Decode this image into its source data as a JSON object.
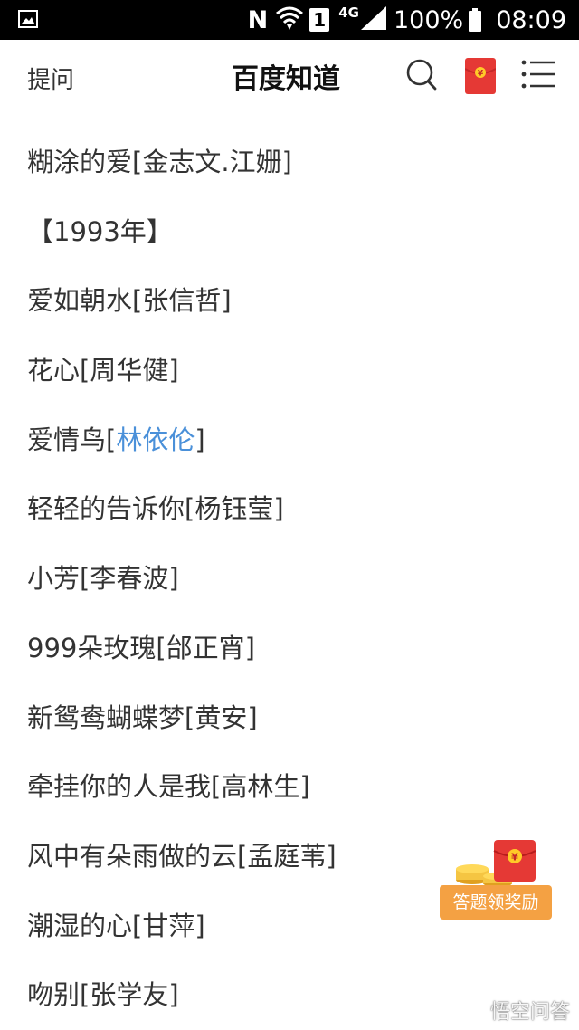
{
  "status_bar": {
    "nfc": "N",
    "sim": "1",
    "network": "4G",
    "battery": "100%",
    "time": "08:09"
  },
  "header": {
    "ask_label": "提问",
    "title": "百度知道"
  },
  "songs": [
    "糊涂的爱[金志文.江姗]",
    "【1993年】",
    "爱如朝水[张信哲]",
    "花心[周华健]",
    {
      "prefix": "爱情鸟[",
      "link": "林依伦",
      "suffix": "]"
    },
    "轻轻的告诉你[杨钰莹]",
    "小芳[李春波]",
    "999朵玫瑰[邰正宵]",
    "新鸳鸯蝴蝶梦[黄安]",
    "牵挂你的人是我[高林生]",
    "风中有朵雨做的云[孟庭苇]",
    "潮湿的心[甘萍]",
    "吻别[张学友]"
  ],
  "reward": {
    "label": "答题领奖励",
    "currency_symbol": "¥"
  },
  "watermark": "悟空问答",
  "colors": {
    "link": "#4a90d9",
    "reward_orange": "#f4a143",
    "red_packet": "#e53935"
  }
}
